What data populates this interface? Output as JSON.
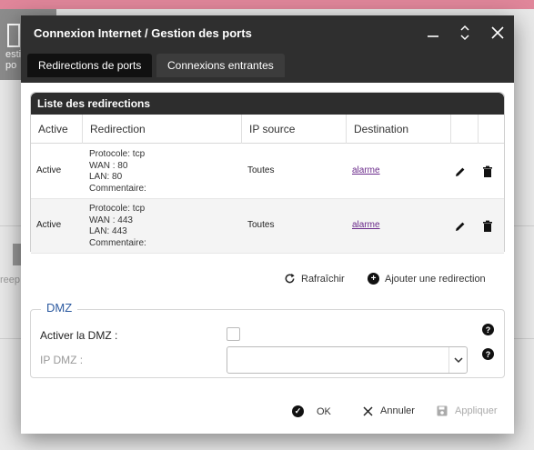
{
  "background": {
    "tile_text": "estio\npo",
    "left_text": "reep"
  },
  "dialog": {
    "title": "Connexion Internet / Gestion des ports",
    "tabs": [
      {
        "label": "Redirections de ports",
        "active": true
      },
      {
        "label": "Connexions entrantes",
        "active": false
      }
    ],
    "list": {
      "title": "Liste des redirections",
      "columns": [
        "Active",
        "Redirection",
        "IP source",
        "Destination"
      ],
      "rows": [
        {
          "active": "Active",
          "protocole": "Protocole: tcp",
          "wan": "WAN : 80",
          "lan": "LAN: 80",
          "commentaire": "Commentaire:",
          "ip_source": "Toutes",
          "destination": "alarme"
        },
        {
          "active": "Active",
          "protocole": "Protocole: tcp",
          "wan": "WAN : 443",
          "lan": "LAN: 443",
          "commentaire": "Commentaire:",
          "ip_source": "Toutes",
          "destination": "alarme"
        }
      ],
      "refresh_label": "Rafraîchir",
      "add_label": "Ajouter une redirection"
    },
    "dmz": {
      "legend": "DMZ",
      "activate_label": "Activer la DMZ :",
      "activate_checked": false,
      "ip_label": "IP DMZ :",
      "ip_value": ""
    },
    "footer": {
      "ok_label": "OK",
      "cancel_label": "Annuler",
      "apply_label": "Appliquer"
    }
  },
  "colors": {
    "header": "#2f2f2f",
    "link": "#6a2a8a",
    "dmz_legend": "#2c5aa0",
    "top_strip": "#e0869a"
  }
}
